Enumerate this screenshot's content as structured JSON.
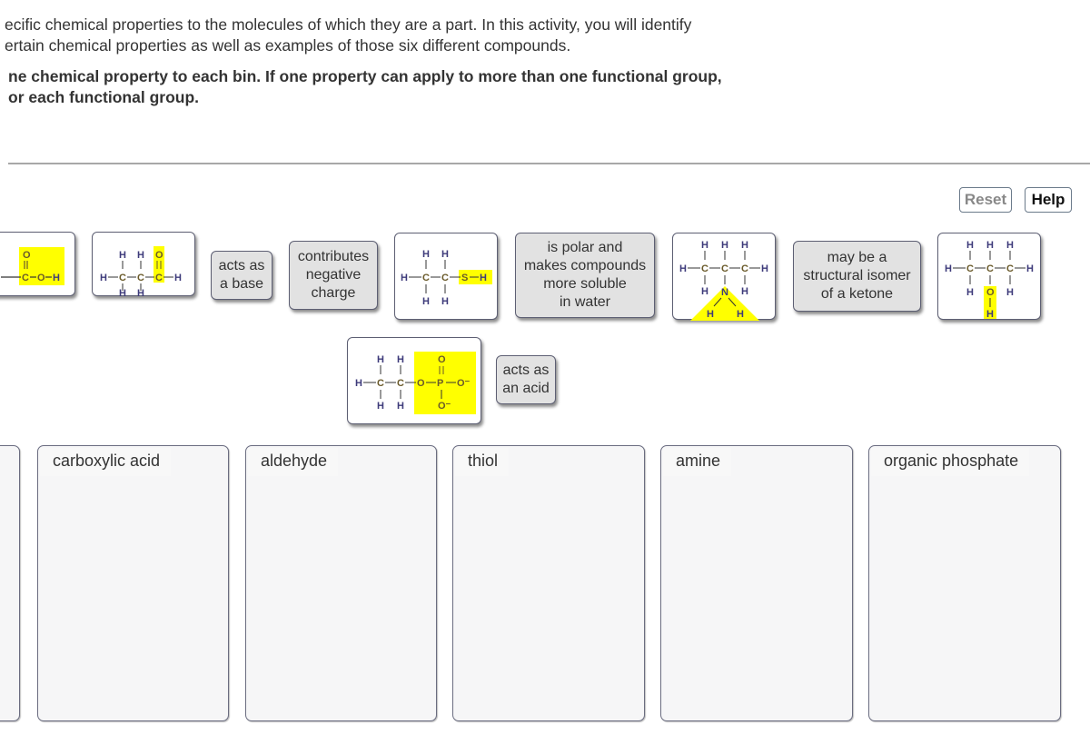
{
  "instructions": {
    "intro_line1": "ecific chemical properties to the molecules of which they are a part. In this activity, you will identify",
    "intro_line2": "ertain chemical properties as well as examples of those six different compounds.",
    "task_line1": "ne chemical property to each bin. If one property can apply to more than one functional group,",
    "task_line2": "or each functional group."
  },
  "toolbar": {
    "reset_label": "Reset",
    "help_label": "Help"
  },
  "colors": {
    "highlight": "#ffff00",
    "atom_c": "#6a5a2a",
    "atom_h": "#3d3a7a"
  },
  "tiles": {
    "properties": [
      {
        "id": "base",
        "lines": [
          "acts as",
          "a base"
        ]
      },
      {
        "id": "negative",
        "lines": [
          "contributes",
          "negative",
          "charge"
        ]
      },
      {
        "id": "polar",
        "lines": [
          "is polar and",
          "makes compounds",
          "more soluble",
          "in water"
        ]
      },
      {
        "id": "isomer",
        "lines": [
          "may be a",
          "structural isomer",
          "of a ketone"
        ]
      },
      {
        "id": "acid",
        "lines": [
          "acts as",
          "an acid"
        ]
      }
    ],
    "molecules": [
      {
        "id": "carboxyl",
        "group": "carboxyl",
        "highlight": "C=O, O-H"
      },
      {
        "id": "propanal",
        "group": "aldehyde",
        "highlight": "C=O"
      },
      {
        "id": "ethanethiol",
        "group": "thiol",
        "highlight": "S-H"
      },
      {
        "id": "propylamine",
        "group": "amine",
        "highlight": "NH2"
      },
      {
        "id": "propanol",
        "group": "hydroxyl",
        "highlight": "O-H"
      },
      {
        "id": "ethylphosphate",
        "group": "phosphate",
        "highlight": "O-PO3"
      }
    ]
  },
  "bins": [
    {
      "label": ""
    },
    {
      "label": "carboxylic acid"
    },
    {
      "label": "aldehyde"
    },
    {
      "label": "thiol"
    },
    {
      "label": "amine"
    },
    {
      "label": "organic phosphate"
    }
  ]
}
